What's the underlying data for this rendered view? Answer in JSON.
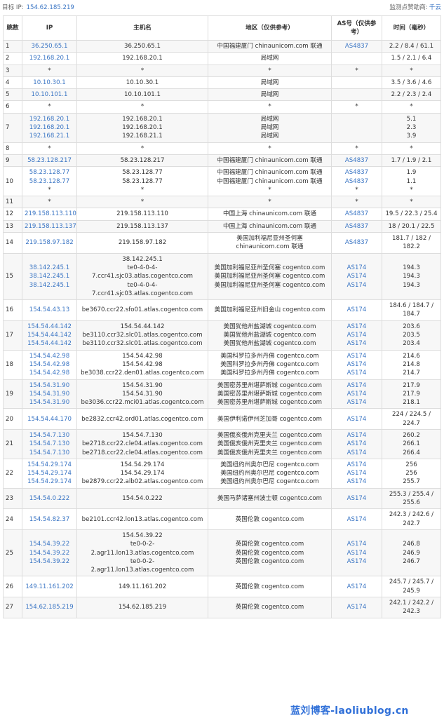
{
  "header": {
    "target_label": "目标 IP:",
    "target_ip": "154.62.185.219",
    "sponsor_label": "监测点赞助商:",
    "sponsor": "千云"
  },
  "columns": [
    "跳数",
    "IP",
    "主机名",
    "地区（仅供参考）",
    "AS号（仅供参考）",
    "时间（毫秒）"
  ],
  "rows": [
    {
      "hop": "1",
      "ips": [
        "36.250.65.1"
      ],
      "hosts": [
        "36.250.65.1"
      ],
      "locs": [
        "中国福建厦门 chinaunicom.com 联通"
      ],
      "as": [
        "AS4837"
      ],
      "times": [
        "2.2 / 8.4 / 61.1"
      ]
    },
    {
      "hop": "2",
      "ips": [
        "192.168.20.1"
      ],
      "hosts": [
        "192.168.20.1"
      ],
      "locs": [
        "局域网"
      ],
      "as": [],
      "times": [
        "1.5 / 2.1 / 6.4"
      ]
    },
    {
      "hop": "3",
      "ips": [
        "*"
      ],
      "hosts": [
        "*"
      ],
      "locs": [
        "*"
      ],
      "as": [
        "*"
      ],
      "times": [
        "*"
      ]
    },
    {
      "hop": "4",
      "ips": [
        "10.10.30.1"
      ],
      "hosts": [
        "10.10.30.1"
      ],
      "locs": [
        "局域网"
      ],
      "as": [],
      "times": [
        "3.5 / 3.6 / 4.6"
      ]
    },
    {
      "hop": "5",
      "ips": [
        "10.10.101.1"
      ],
      "hosts": [
        "10.10.101.1"
      ],
      "locs": [
        "局域网"
      ],
      "as": [],
      "times": [
        "2.2 / 2.3 / 2.4"
      ]
    },
    {
      "hop": "6",
      "ips": [
        "*"
      ],
      "hosts": [
        "*"
      ],
      "locs": [
        "*"
      ],
      "as": [
        "*"
      ],
      "times": [
        "*"
      ]
    },
    {
      "hop": "7",
      "ips": [
        "192.168.20.1",
        "192.168.20.1",
        "192.168.21.1"
      ],
      "hosts": [
        "192.168.20.1",
        "192.168.20.1",
        "192.168.21.1"
      ],
      "locs": [
        "局域网",
        "局域网",
        "局域网"
      ],
      "as": [],
      "times": [
        "5.1",
        "2.3",
        "3.9"
      ]
    },
    {
      "hop": "8",
      "ips": [
        "*"
      ],
      "hosts": [
        "*"
      ],
      "locs": [
        "*"
      ],
      "as": [
        "*"
      ],
      "times": [
        "*"
      ]
    },
    {
      "hop": "9",
      "ips": [
        "58.23.128.217"
      ],
      "hosts": [
        "58.23.128.217"
      ],
      "locs": [
        "中国福建厦门 chinaunicom.com 联通"
      ],
      "as": [
        "AS4837"
      ],
      "times": [
        "1.7 / 1.9 / 2.1"
      ]
    },
    {
      "hop": "10",
      "ips": [
        "58.23.128.77",
        "58.23.128.77",
        "*"
      ],
      "hosts": [
        "58.23.128.77",
        "58.23.128.77",
        "*"
      ],
      "locs": [
        "中国福建厦门 chinaunicom.com 联通",
        "中国福建厦门 chinaunicom.com 联通",
        "*"
      ],
      "as": [
        "AS4837",
        "AS4837",
        "*"
      ],
      "times": [
        "1.9",
        "1.1",
        "*"
      ]
    },
    {
      "hop": "11",
      "ips": [
        "*"
      ],
      "hosts": [
        "*"
      ],
      "locs": [
        "*"
      ],
      "as": [
        "*"
      ],
      "times": [
        "*"
      ]
    },
    {
      "hop": "12",
      "ips": [
        "219.158.113.110"
      ],
      "hosts": [
        "219.158.113.110"
      ],
      "locs": [
        "中国上海 chinaunicom.com 联通"
      ],
      "as": [
        "AS4837"
      ],
      "times": [
        "19.5 / 22.3 / 25.4"
      ]
    },
    {
      "hop": "13",
      "ips": [
        "219.158.113.137"
      ],
      "hosts": [
        "219.158.113.137"
      ],
      "locs": [
        "中国上海 chinaunicom.com 联通"
      ],
      "as": [
        "AS4837"
      ],
      "times": [
        "18 / 20.1 / 22.5"
      ]
    },
    {
      "hop": "14",
      "ips": [
        "219.158.97.182"
      ],
      "hosts": [
        "219.158.97.182"
      ],
      "locs": [
        "美国加利福尼亚州圣何塞 chinaunicom.com 联通"
      ],
      "as": [
        "AS4837"
      ],
      "times": [
        "181.7 / 182 / 182.2"
      ]
    },
    {
      "hop": "15",
      "ips": [
        "38.142.245.1",
        "38.142.245.1",
        "38.142.245.1"
      ],
      "hosts": [
        "38.142.245.1",
        "te0-4-0-4-7.ccr41.sjc03.atlas.cogentco.com",
        "te0-4-0-4-7.ccr41.sjc03.atlas.cogentco.com"
      ],
      "locs": [
        "美国加利福尼亚州圣何塞 cogentco.com",
        "美国加利福尼亚州圣何塞 cogentco.com",
        "美国加利福尼亚州圣何塞 cogentco.com"
      ],
      "as": [
        "AS174",
        "AS174",
        "AS174"
      ],
      "times": [
        "194.3",
        "194.3",
        "194.3"
      ]
    },
    {
      "hop": "16",
      "ips": [
        "154.54.43.13"
      ],
      "hosts": [
        "be3670.ccr22.sfo01.atlas.cogentco.com"
      ],
      "locs": [
        "美国加利福尼亚州旧金山 cogentco.com"
      ],
      "as": [
        "AS174"
      ],
      "times": [
        "184.6 / 184.7 / 184.7"
      ]
    },
    {
      "hop": "17",
      "ips": [
        "154.54.44.142",
        "154.54.44.142",
        "154.54.44.142"
      ],
      "hosts": [
        "154.54.44.142",
        "be3110.ccr32.slc01.atlas.cogentco.com",
        "be3110.ccr32.slc01.atlas.cogentco.com"
      ],
      "locs": [
        "美国犹他州盐湖城 cogentco.com",
        "美国犹他州盐湖城 cogentco.com",
        "美国犹他州盐湖城 cogentco.com"
      ],
      "as": [
        "AS174",
        "AS174",
        "AS174"
      ],
      "times": [
        "203.6",
        "203.5",
        "203.4"
      ]
    },
    {
      "hop": "18",
      "ips": [
        "154.54.42.98",
        "154.54.42.98",
        "154.54.42.98"
      ],
      "hosts": [
        "154.54.42.98",
        "154.54.42.98",
        "be3038.ccr22.den01.atlas.cogentco.com"
      ],
      "locs": [
        "美国科罗拉多州丹佛 cogentco.com",
        "美国科罗拉多州丹佛 cogentco.com",
        "美国科罗拉多州丹佛 cogentco.com"
      ],
      "as": [
        "AS174",
        "AS174",
        "AS174"
      ],
      "times": [
        "214.6",
        "214.8",
        "214.7"
      ]
    },
    {
      "hop": "19",
      "ips": [
        "154.54.31.90",
        "154.54.31.90",
        "154.54.31.90"
      ],
      "hosts": [
        "154.54.31.90",
        "154.54.31.90",
        "be3036.ccr22.mci01.atlas.cogentco.com"
      ],
      "locs": [
        "美国密苏里州堪萨斯城 cogentco.com",
        "美国密苏里州堪萨斯城 cogentco.com",
        "美国密苏里州堪萨斯城 cogentco.com"
      ],
      "as": [
        "AS174",
        "AS174",
        "AS174"
      ],
      "times": [
        "217.9",
        "217.9",
        "218.1"
      ]
    },
    {
      "hop": "20",
      "ips": [
        "154.54.44.170"
      ],
      "hosts": [
        "be2832.ccr42.ord01.atlas.cogentco.com"
      ],
      "locs": [
        "美国伊利诺伊州芝加哥 cogentco.com"
      ],
      "as": [
        "AS174"
      ],
      "times": [
        "224 / 224.5 / 224.7"
      ]
    },
    {
      "hop": "21",
      "ips": [
        "154.54.7.130",
        "154.54.7.130",
        "154.54.7.130"
      ],
      "hosts": [
        "154.54.7.130",
        "be2718.ccr22.cle04.atlas.cogentco.com",
        "be2718.ccr22.cle04.atlas.cogentco.com"
      ],
      "locs": [
        "美国俄亥俄州克里夫兰 cogentco.com",
        "美国俄亥俄州克里夫兰 cogentco.com",
        "美国俄亥俄州克里夫兰 cogentco.com"
      ],
      "as": [
        "AS174",
        "AS174",
        "AS174"
      ],
      "times": [
        "260.2",
        "266.1",
        "266.4"
      ]
    },
    {
      "hop": "22",
      "ips": [
        "154.54.29.174",
        "154.54.29.174",
        "154.54.29.174"
      ],
      "hosts": [
        "154.54.29.174",
        "154.54.29.174",
        "be2879.ccr22.alb02.atlas.cogentco.com"
      ],
      "locs": [
        "美国纽约州奥尔巴尼 cogentco.com",
        "美国纽约州奥尔巴尼 cogentco.com",
        "美国纽约州奥尔巴尼 cogentco.com"
      ],
      "as": [
        "AS174",
        "AS174",
        "AS174"
      ],
      "times": [
        "256",
        "256",
        "255.7"
      ]
    },
    {
      "hop": "23",
      "ips": [
        "154.54.0.222"
      ],
      "hosts": [
        "154.54.0.222"
      ],
      "locs": [
        "美国马萨诸塞州波士顿 cogentco.com"
      ],
      "as": [
        "AS174"
      ],
      "times": [
        "255.3 / 255.4 / 255.6"
      ]
    },
    {
      "hop": "24",
      "ips": [
        "154.54.82.37"
      ],
      "hosts": [
        "be2101.ccr42.lon13.atlas.cogentco.com"
      ],
      "locs": [
        "英国伦敦 cogentco.com"
      ],
      "as": [
        "AS174"
      ],
      "times": [
        "242.3 / 242.6 / 242.7"
      ]
    },
    {
      "hop": "25",
      "ips": [
        "154.54.39.22",
        "154.54.39.22",
        "154.54.39.22"
      ],
      "hosts": [
        "154.54.39.22",
        "te0-0-2-2.agr11.lon13.atlas.cogentco.com",
        "te0-0-2-2.agr11.lon13.atlas.cogentco.com"
      ],
      "locs": [
        "英国伦敦 cogentco.com",
        "英国伦敦 cogentco.com",
        "英国伦敦 cogentco.com"
      ],
      "as": [
        "AS174",
        "AS174",
        "AS174"
      ],
      "times": [
        "246.8",
        "246.9",
        "246.7"
      ]
    },
    {
      "hop": "26",
      "ips": [
        "149.11.161.202"
      ],
      "hosts": [
        "149.11.161.202"
      ],
      "locs": [
        "英国伦敦 cogentco.com"
      ],
      "as": [
        "AS174"
      ],
      "times": [
        "245.7 / 245.7 / 245.9"
      ]
    },
    {
      "hop": "27",
      "ips": [
        "154.62.185.219"
      ],
      "hosts": [
        "154.62.185.219"
      ],
      "locs": [
        "英国伦敦 cogentco.com"
      ],
      "as": [
        "AS174"
      ],
      "times": [
        "242.1 / 242.2 / 242.3"
      ]
    }
  ],
  "watermark": "蓝刘博客-laoliublog.cn",
  "colors": {
    "link": "#3a75c4",
    "border": "#dddddd",
    "stripe": "#f7f7f7",
    "watermark": "#2f6fd8"
  }
}
